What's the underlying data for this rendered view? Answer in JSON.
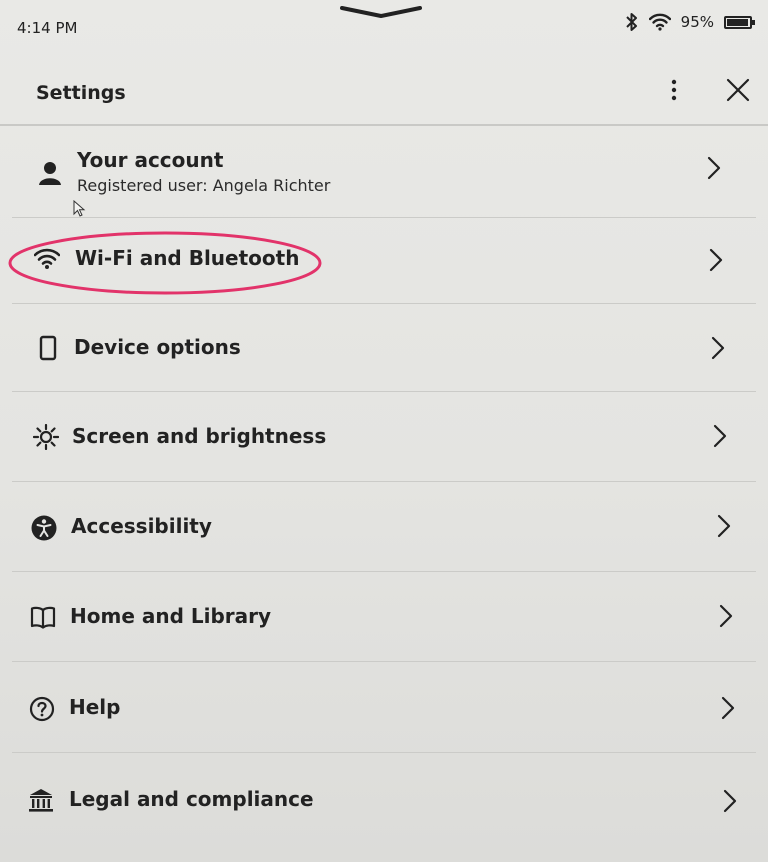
{
  "status_bar": {
    "time": "4:14 PM",
    "battery_percent": "95%",
    "battery_level": 0.95,
    "icons": [
      "bluetooth-icon",
      "wifi-icon",
      "battery-icon"
    ]
  },
  "header": {
    "title": "Settings",
    "icons": [
      "more-options-icon",
      "close-icon"
    ]
  },
  "settings_items": [
    {
      "label": "Your account",
      "subtitle": "Registered user: Angela Richter",
      "icon": "person-icon"
    },
    {
      "label": "Wi-Fi and Bluetooth",
      "icon": "wifi-icon",
      "highlighted": true
    },
    {
      "label": "Device options",
      "icon": "device-icon"
    },
    {
      "label": "Screen and brightness",
      "icon": "brightness-icon"
    },
    {
      "label": "Accessibility",
      "icon": "accessibility-icon"
    },
    {
      "label": "Home and Library",
      "icon": "book-icon"
    },
    {
      "label": "Help",
      "icon": "help-icon"
    },
    {
      "label": "Legal and compliance",
      "icon": "bank-icon"
    }
  ],
  "annotation": {
    "color": "#e2336a"
  }
}
